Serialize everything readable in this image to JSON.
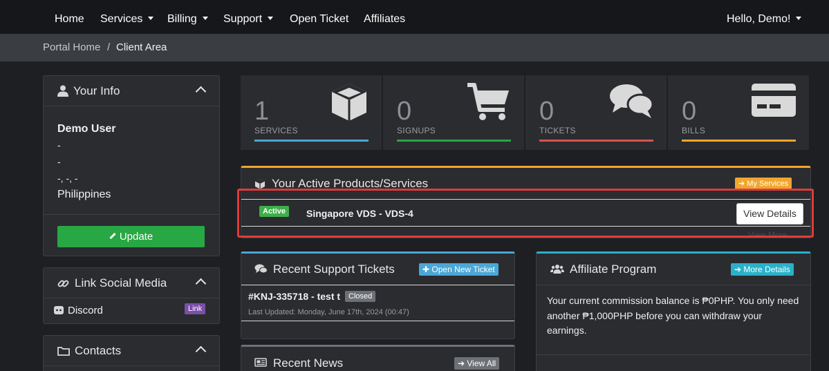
{
  "nav": {
    "home": "Home",
    "services": "Services",
    "billing": "Billing",
    "support": "Support",
    "open_ticket": "Open Ticket",
    "affiliates": "Affiliates",
    "greeting": "Hello, Demo!"
  },
  "breadcrumb": {
    "home": "Portal Home",
    "sep": "/",
    "current": "Client Area"
  },
  "your_info": {
    "title": "Your Info",
    "name": "Demo User",
    "line1": "-",
    "line2": "-",
    "line3": "-, -, -",
    "country": "Philippines",
    "update_label": "Update"
  },
  "social": {
    "title": "Link Social Media",
    "discord": "Discord",
    "link_badge": "Link"
  },
  "contacts": {
    "title": "Contacts"
  },
  "stats": [
    {
      "value": "1",
      "label": "SERVICES",
      "color": "#4aa7d6",
      "icon": "cube-icon"
    },
    {
      "value": "0",
      "label": "SIGNUPS",
      "color": "#28a745",
      "icon": "cart-icon"
    },
    {
      "value": "0",
      "label": "TICKETS",
      "color": "#d9534f",
      "icon": "comments-icon"
    },
    {
      "value": "0",
      "label": "BILLS",
      "color": "#f0a630",
      "icon": "credit-card-icon"
    }
  ],
  "products": {
    "title": "Your Active Products/Services",
    "my_services": "My Services",
    "status": "Active",
    "service_name": "Singapore VDS - VDS-4",
    "view_details": "View Details",
    "view_more": "View More..."
  },
  "tickets": {
    "title": "Recent Support Tickets",
    "open_new": "Open New Ticket",
    "ticket_title": "#KNJ-335718 - test t",
    "ticket_status": "Closed",
    "last_updated": "Last Updated: Monday, June 17th, 2024 (00:47)"
  },
  "affiliate": {
    "title": "Affiliate Program",
    "more_details": "More Details",
    "text": "Your current commission balance is ₱0PHP. You only need another ₱1,000PHP before you can withdraw your earnings."
  },
  "news": {
    "title": "Recent News",
    "view_all": "View All"
  },
  "colors": {
    "accent_green": "#28a745",
    "accent_orange": "#f0a630",
    "accent_cyan": "#2bb0c9",
    "highlight_red": "#e03b3b"
  }
}
